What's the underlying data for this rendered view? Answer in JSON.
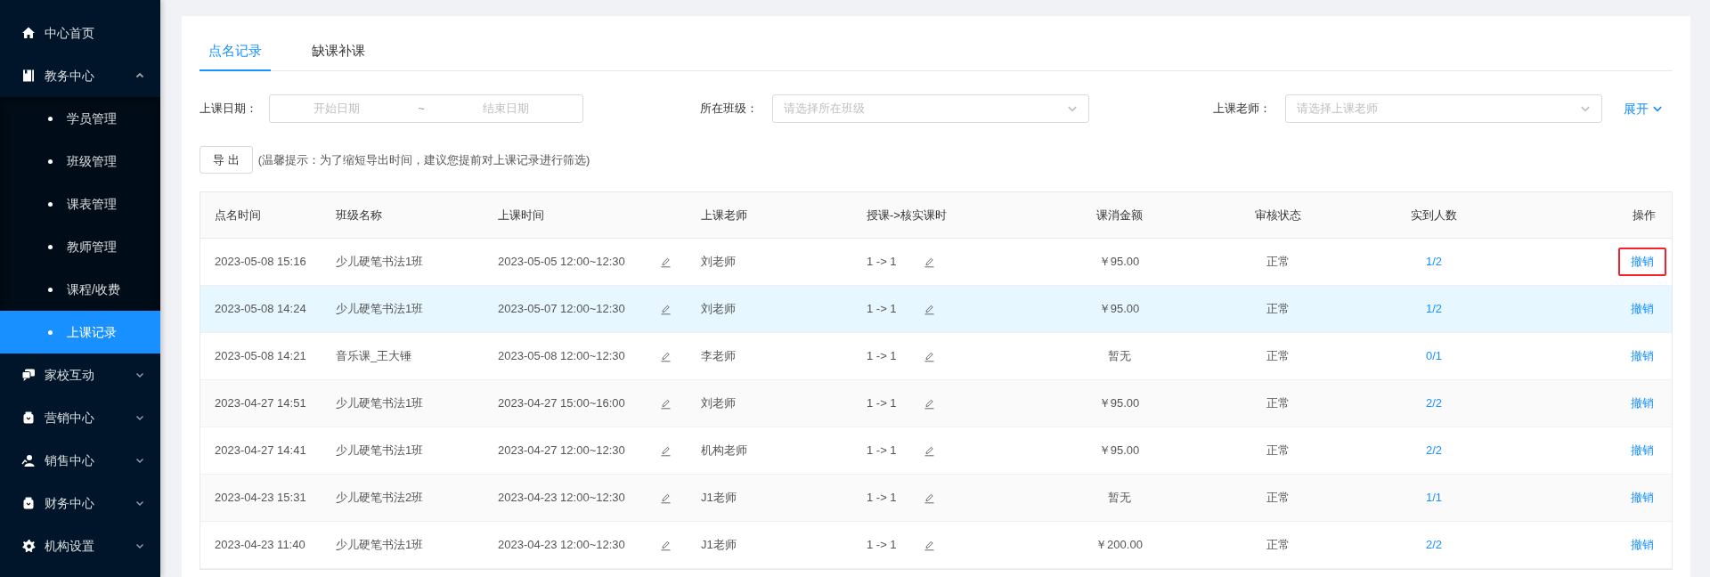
{
  "sidebar": {
    "items": [
      {
        "label": "中心首页",
        "selected": false
      },
      {
        "label": "教务中心",
        "selected": false,
        "expanded": true,
        "children": [
          {
            "label": "学员管理",
            "selected": false
          },
          {
            "label": "班级管理",
            "selected": false
          },
          {
            "label": "课表管理",
            "selected": false
          },
          {
            "label": "教师管理",
            "selected": false
          },
          {
            "label": "课程/收费",
            "selected": false
          },
          {
            "label": "上课记录",
            "selected": true
          }
        ]
      },
      {
        "label": "家校互动",
        "selected": false,
        "expanded": false
      },
      {
        "label": "营销中心",
        "selected": false,
        "expanded": false
      },
      {
        "label": "销售中心",
        "selected": false,
        "expanded": false
      },
      {
        "label": "财务中心",
        "selected": false,
        "expanded": false
      },
      {
        "label": "机构设置",
        "selected": false,
        "expanded": false
      }
    ]
  },
  "tabs": [
    {
      "label": "点名记录",
      "selected": true
    },
    {
      "label": "缺课补课",
      "selected": false
    }
  ],
  "filters": {
    "date": {
      "label": "上课日期：",
      "start_placeholder": "开始日期",
      "separator": "~",
      "end_placeholder": "结束日期"
    },
    "class": {
      "label": "所在班级：",
      "placeholder": "请选择所在班级"
    },
    "teacher": {
      "label": "上课老师：",
      "placeholder": "请选择上课老师"
    },
    "expand_link": "展开"
  },
  "export": {
    "button": "导 出",
    "hint": "(温馨提示：为了缩短导出时间，建议您提前对上课记录进行筛选)"
  },
  "table": {
    "columns": [
      "点名时间",
      "班级名称",
      "上课时间",
      "上课老师",
      "授课->核实课时",
      "课消金额",
      "审核状态",
      "实到人数",
      "操作"
    ],
    "rows": [
      {
        "roll_time": "2023-05-08 15:16",
        "class": "少儿硬笔书法1班",
        "lesson_time": "2023-05-05 12:00~12:30",
        "teacher": "刘老师",
        "hours": "1 -> 1",
        "amount": "￥95.00",
        "status": "正常",
        "attendance": "1/2",
        "action": "撤销",
        "highlighted": false,
        "outlined": true
      },
      {
        "roll_time": "2023-05-08 14:24",
        "class": "少儿硬笔书法1班",
        "lesson_time": "2023-05-07 12:00~12:30",
        "teacher": "刘老师",
        "hours": "1 -> 1",
        "amount": "￥95.00",
        "status": "正常",
        "attendance": "1/2",
        "action": "撤销",
        "highlighted": true,
        "outlined": false
      },
      {
        "roll_time": "2023-05-08 14:21",
        "class": "音乐课_王大锤",
        "lesson_time": "2023-05-08 12:00~12:30",
        "teacher": "李老师",
        "hours": "1 -> 1",
        "amount": "暂无",
        "status": "正常",
        "attendance": "0/1",
        "action": "撤销",
        "highlighted": false,
        "outlined": false
      },
      {
        "roll_time": "2023-04-27 14:51",
        "class": "少儿硬笔书法1班",
        "lesson_time": "2023-04-27 15:00~16:00",
        "teacher": "刘老师",
        "hours": "1 -> 1",
        "amount": "￥95.00",
        "status": "正常",
        "attendance": "2/2",
        "action": "撤销",
        "highlighted": false,
        "outlined": false
      },
      {
        "roll_time": "2023-04-27 14:41",
        "class": "少儿硬笔书法1班",
        "lesson_time": "2023-04-27 12:00~12:30",
        "teacher": "机构老师",
        "hours": "1 -> 1",
        "amount": "￥95.00",
        "status": "正常",
        "attendance": "2/2",
        "action": "撤销",
        "highlighted": false,
        "outlined": false
      },
      {
        "roll_time": "2023-04-23 15:31",
        "class": "少儿硬笔书法2班",
        "lesson_time": "2023-04-23 12:00~12:30",
        "teacher": "J1老师",
        "hours": "1 -> 1",
        "amount": "暂无",
        "status": "正常",
        "attendance": "1/1",
        "action": "撤销",
        "highlighted": false,
        "outlined": false
      },
      {
        "roll_time": "2023-04-23 11:40",
        "class": "少儿硬笔书法1班",
        "lesson_time": "2023-04-23 12:00~12:30",
        "teacher": "J1老师",
        "hours": "1 -> 1",
        "amount": "￥200.00",
        "status": "正常",
        "attendance": "2/2",
        "action": "撤销",
        "highlighted": false,
        "outlined": false
      }
    ]
  }
}
